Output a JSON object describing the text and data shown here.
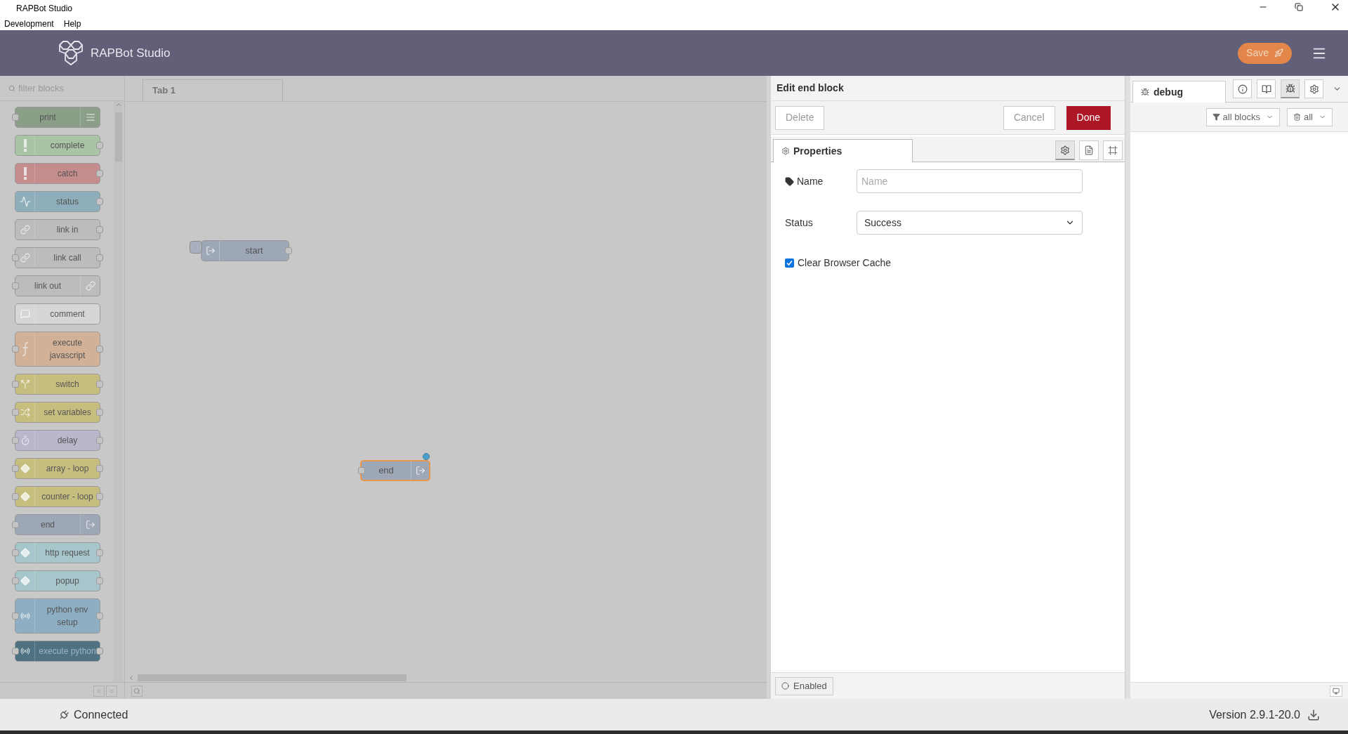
{
  "window": {
    "title": "RAPBot Studio",
    "menu": [
      "Development",
      "Help"
    ]
  },
  "header": {
    "title": "RAPBot Studio",
    "save_button": "Save"
  },
  "palette": {
    "filter_placeholder": "filter blocks",
    "blocks": [
      {
        "label": "print",
        "color": "#8a9e88",
        "kind": "list",
        "icon_right": true,
        "input": true,
        "output": false
      },
      {
        "label": "complete",
        "color": "#a8c4a4",
        "kind": "bang",
        "icon_right": false,
        "input": false,
        "output": true
      },
      {
        "label": "catch",
        "color": "#c48c8c",
        "kind": "bang",
        "icon_right": false,
        "input": false,
        "output": true
      },
      {
        "label": "status",
        "color": "#8eaebc",
        "kind": "wave",
        "icon_right": false,
        "input": false,
        "output": true
      },
      {
        "label": "link in",
        "color": "#bcbcbc",
        "kind": "link",
        "icon_right": false,
        "input": false,
        "output": true
      },
      {
        "label": "link call",
        "color": "#bcbcbc",
        "kind": "link",
        "icon_right": false,
        "input": true,
        "output": true
      },
      {
        "label": "link out",
        "color": "#bcbcbc",
        "kind": "link",
        "icon_right": true,
        "input": true,
        "output": false
      },
      {
        "label": "comment",
        "color": "#d6d6d6",
        "kind": "comment",
        "icon_right": false,
        "input": false,
        "output": false
      },
      {
        "label": "execute javascript",
        "color": "#d2b196",
        "kind": "func",
        "icon_right": false,
        "input": true,
        "output": true
      },
      {
        "label": "switch",
        "color": "#c6be7e",
        "kind": "split",
        "icon_right": false,
        "input": true,
        "output": true
      },
      {
        "label": "set variables",
        "color": "#c6be7e",
        "kind": "shuffle",
        "icon_right": false,
        "input": true,
        "output": true
      },
      {
        "label": "delay",
        "color": "#bab6cc",
        "kind": "timer",
        "icon_right": false,
        "input": true,
        "output": true
      },
      {
        "label": "array - loop",
        "color": "#c6be7e",
        "kind": "loop",
        "icon_right": false,
        "input": true,
        "output": true
      },
      {
        "label": "counter - loop",
        "color": "#c6be7e",
        "kind": "loop",
        "icon_right": false,
        "input": true,
        "output": true
      },
      {
        "label": "end",
        "color": "#9ea7b6",
        "kind": "exit",
        "icon_right": true,
        "input": true,
        "output": false
      },
      {
        "label": "http request",
        "color": "#a6c6cb",
        "kind": "loop",
        "icon_right": false,
        "input": true,
        "output": true
      },
      {
        "label": "popup",
        "color": "#a6c6cb",
        "kind": "loop",
        "icon_right": false,
        "input": true,
        "output": true
      },
      {
        "label": "python env setup",
        "color": "#8daec3",
        "kind": "signal",
        "icon_right": false,
        "input": true,
        "output": true
      },
      {
        "label": "execute python",
        "color": "#4f7282",
        "kind": "signal",
        "icon_right": false,
        "input": true,
        "output": true
      }
    ]
  },
  "workspace": {
    "tabs": [
      {
        "label": "Tab 1",
        "selected": true
      }
    ],
    "nodes": [
      {
        "label": "start",
        "color": "#9ea7b6",
        "selected": false,
        "changed": false,
        "input": false,
        "output": true,
        "icon_right": false
      },
      {
        "label": "end",
        "color": "#9ea7b6",
        "selected": true,
        "changed": true,
        "input": true,
        "output": false,
        "icon_right": true
      }
    ]
  },
  "editor": {
    "title": "Edit end block",
    "delete_button": "Delete",
    "cancel_button": "Cancel",
    "done_button": "Done",
    "tabs": [
      {
        "label": "Properties",
        "selected": true
      }
    ],
    "icon_tabs": [
      {
        "kind": "settings",
        "selected": true
      },
      {
        "kind": "description",
        "selected": false
      },
      {
        "kind": "appearance",
        "selected": false
      }
    ],
    "fields": [
      {
        "kind": "text",
        "label": "Name",
        "placeholder": "Name"
      },
      {
        "kind": "select",
        "label": "Status",
        "value": "Success"
      },
      {
        "kind": "checkbox",
        "label": "Clear Browser Cache",
        "checked": true
      }
    ],
    "enabled_button": "Enabled"
  },
  "sidebar": {
    "tab": "debug",
    "icon_tabs": [
      {
        "kind": "info",
        "selected": false
      },
      {
        "kind": "help",
        "selected": false
      },
      {
        "kind": "debug",
        "selected": true
      },
      {
        "kind": "config",
        "selected": false
      }
    ],
    "filter_button": "all blocks",
    "clear_button": "all"
  },
  "status_bar": {
    "connection": "Connected",
    "version": "Version 2.9.1-20.0"
  }
}
